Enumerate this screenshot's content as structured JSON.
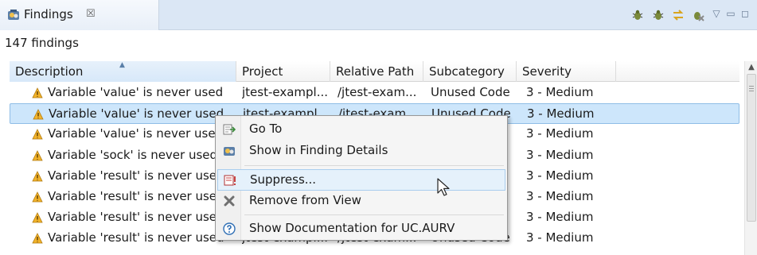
{
  "view": {
    "tab_title": "Findings",
    "tab_close": "☒",
    "count_text": "147 findings"
  },
  "toolbar": {
    "minimize_glyph": "▽",
    "restore_glyph": "▭",
    "maximize_glyph": "◻"
  },
  "table": {
    "columns": [
      "Description",
      "Project",
      "Relative Path",
      "Subcategory",
      "Severity"
    ],
    "sorted_column": "Description",
    "rows": [
      {
        "description": "Variable 'value' is never used",
        "project": "jtest-exampl...",
        "path": "/jtest-exam...",
        "subcategory": "Unused Code",
        "severity": "3 - Medium"
      },
      {
        "description": "Variable 'value' is never used",
        "project": "jtest-exampl...",
        "path": "/jtest-exam...",
        "subcategory": "Unused Code",
        "severity": "3 - Medium",
        "selected": true
      },
      {
        "description": "Variable 'value' is never use",
        "project": "",
        "path": "",
        "subcategory": "e",
        "severity": "3 - Medium"
      },
      {
        "description": "Variable 'sock' is never used",
        "project": "",
        "path": "",
        "subcategory": "e",
        "severity": "3 - Medium"
      },
      {
        "description": "Variable 'result' is never use",
        "project": "",
        "path": "",
        "subcategory": "e",
        "severity": "3 - Medium"
      },
      {
        "description": "Variable 'result' is never use",
        "project": "",
        "path": "",
        "subcategory": "e",
        "severity": "3 - Medium"
      },
      {
        "description": "Variable 'result' is never use",
        "project": "",
        "path": "",
        "subcategory": "e",
        "severity": "3 - Medium"
      },
      {
        "description": "Variable 'result' is never used",
        "project": "jtest-exampl...",
        "path": "/jtest-exam...",
        "subcategory": "Unused Code",
        "severity": "3 - Medium"
      }
    ]
  },
  "context_menu": {
    "items": [
      {
        "label": "Go To",
        "icon": "goto-icon"
      },
      {
        "label": "Show in Finding Details",
        "icon": "finding-details-icon"
      },
      {
        "label": "Suppress...",
        "icon": "suppress-icon",
        "hover": true
      },
      {
        "label": "Remove from View",
        "icon": "remove-icon"
      },
      {
        "label": "Show Documentation for UC.AURV",
        "icon": "help-icon"
      }
    ]
  },
  "colors": {
    "selection": "#cde6fb",
    "menu_hover": "#e5f1fb",
    "warning": "#f2b32a",
    "tab_bar": "#dbe7f5"
  }
}
